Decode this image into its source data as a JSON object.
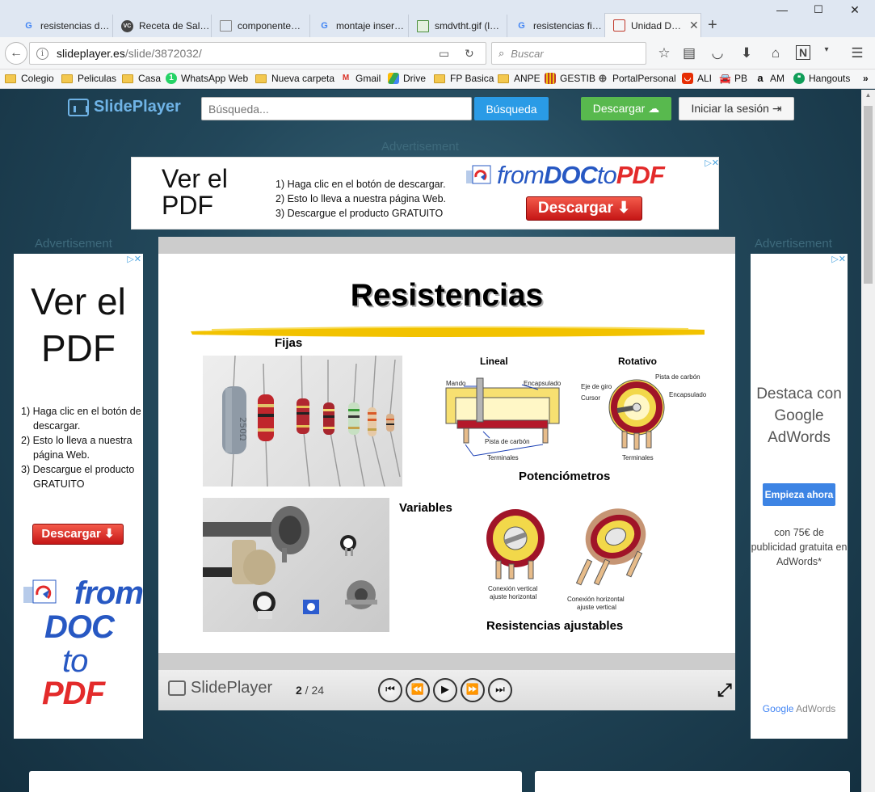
{
  "browser": {
    "tabs": [
      {
        "title": "resistencias d…",
        "icon": "G",
        "icon_color": "#4285f4"
      },
      {
        "title": "Receta de Sal…",
        "icon": "VC",
        "icon_color": "#444444"
      },
      {
        "title": "componente…",
        "icon": "doc",
        "icon_color": "#888888"
      },
      {
        "title": "montaje inser…",
        "icon": "G",
        "icon_color": "#4285f4"
      },
      {
        "title": "smdvtht.gif (l…",
        "icon": "img",
        "icon_color": "#4a8f3c"
      },
      {
        "title": "resistencias fi…",
        "icon": "G",
        "icon_color": "#4285f4"
      },
      {
        "title": "Unidad D…",
        "icon": "slide",
        "icon_color": "#c0392b"
      }
    ],
    "url_host": "slideplayer.es",
    "url_path": "/slide/3872032/",
    "search_placeholder": "Buscar",
    "bookmarks": [
      {
        "label": "Colegio",
        "type": "folder"
      },
      {
        "label": "Peliculas",
        "type": "folder"
      },
      {
        "label": "Casa",
        "type": "folder"
      },
      {
        "label": "WhatsApp Web",
        "type": "whatsapp"
      },
      {
        "label": "Nueva carpeta",
        "type": "folder"
      },
      {
        "label": "Gmail",
        "type": "gmail"
      },
      {
        "label": "Drive",
        "type": "drive"
      },
      {
        "label": "FP Basica",
        "type": "folder"
      },
      {
        "label": "ANPE",
        "type": "folder"
      },
      {
        "label": "GESTIB",
        "type": "gestib"
      },
      {
        "label": "PortalPersonal",
        "type": "globe"
      },
      {
        "label": "ALI",
        "type": "ali"
      },
      {
        "label": "PB",
        "type": "pb"
      },
      {
        "label": "AM",
        "type": "amazon"
      },
      {
        "label": "Hangouts",
        "type": "hangouts"
      }
    ],
    "more_bookmarks": "»"
  },
  "site": {
    "logo": "SlidePlayer",
    "search_placeholder": "Búsqueda...",
    "search_button": "Búsqueda",
    "download_button": "Descargar",
    "login_button": "Iniciar la sesión"
  },
  "ads": {
    "label": "Advertisement",
    "top": {
      "big_line1": "Ver el",
      "big_line2": "PDF",
      "steps": [
        "1) Haga clic en el botón de descargar.",
        "2) Esto lo lleva a nuestra página Web.",
        "3) Descargue el producto GRATUITO"
      ],
      "brand_from": "from",
      "brand_doc": "DOC",
      "brand_to": "to",
      "brand_pdf": "PDF",
      "button": "Descargar"
    },
    "left": {
      "big_line1": "Ver el",
      "big_line2": "PDF",
      "steps": [
        "1) Haga clic en el botón de descargar.",
        "2) Esto lo lleva a nuestra página Web.",
        "3) Descargue el producto GRATUITO"
      ],
      "button": "Descargar",
      "brand_from": "from",
      "brand_doc": "DOC",
      "brand_to": "to",
      "brand_pdf": "PDF"
    },
    "right": {
      "headline": "Destaca con Google AdWords",
      "button": "Empieza ahora",
      "promo": "con 75€ de publicidad gratuita en AdWords*",
      "brand_google": "Google",
      "brand_adwords": "AdWords"
    }
  },
  "slide": {
    "title": "Resistencias",
    "fijas": "Fijas",
    "variables": "Variables",
    "potenciometros": "Potenciómetros",
    "ajustables": "Resistencias ajustables",
    "lineal": "Lineal",
    "rotativo": "Rotativo",
    "lineal_labels": {
      "mando": "Mando",
      "encapsulado": "Encapsulado",
      "pista": "Pista de carbón",
      "terminales": "Terminales"
    },
    "rotativo_labels": {
      "eje": "Eje de giro",
      "cursor": "Cursor",
      "pista": "Pista de carbón",
      "encapsulado": "Encapsulado",
      "terminales": "Terminales"
    },
    "ajuste_labels": {
      "vertical_1": "Conexión vertical",
      "vertical_2": "ajuste horizontal",
      "horizontal_1": "Conexión horizontal",
      "horizontal_2": "ajuste vertical"
    },
    "resistor_marking": "250Ω"
  },
  "viewer": {
    "logo": "SlidePlayer",
    "current_page": "2",
    "separator": " / ",
    "total_pages": "24"
  }
}
